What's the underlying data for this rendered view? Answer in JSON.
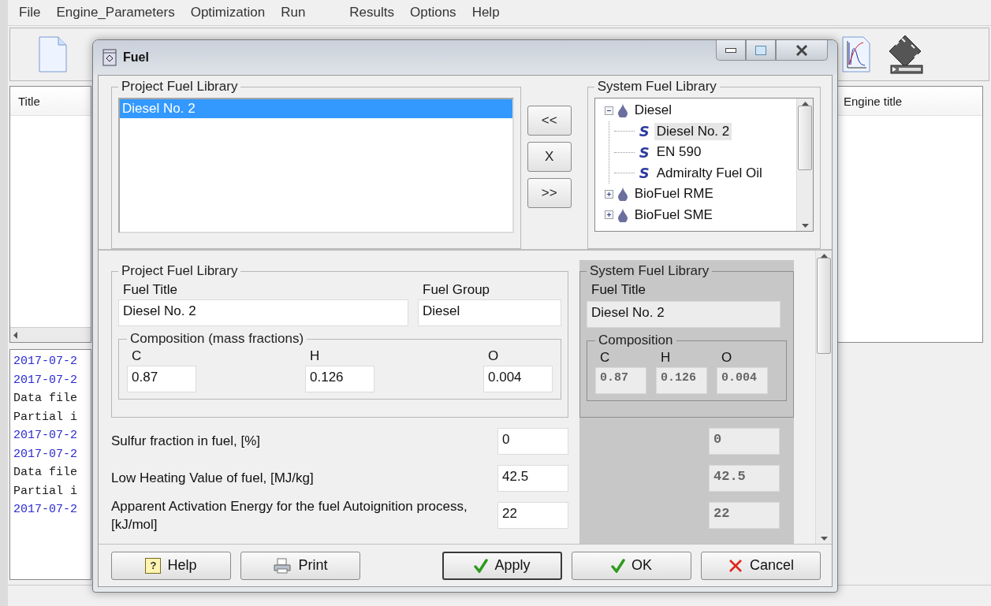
{
  "menu": [
    "File",
    "Engine_Parameters",
    "Optimization",
    "Run",
    "Results",
    "Options",
    "Help"
  ],
  "left_panel": {
    "column": "Title"
  },
  "right_panel": {
    "column": "Engine title"
  },
  "log": [
    {
      "text": "2017-07-2",
      "color": "#2a2ad0"
    },
    {
      "text": "2017-07-2",
      "color": "#2a2ad0"
    },
    {
      "text": "Data file",
      "color": "#1a1a1a"
    },
    {
      "text": "Partial i",
      "color": "#1a1a1a"
    },
    {
      "text": "2017-07-2",
      "color": "#2a2ad0"
    },
    {
      "text": "2017-07-2",
      "color": "#2a2ad0"
    },
    {
      "text": "Data file",
      "color": "#1a1a1a"
    },
    {
      "text": "Partial i",
      "color": "#1a1a1a"
    },
    {
      "text": "2017-07-2",
      "color": "#2a2ad0"
    }
  ],
  "dialog": {
    "title": "Fuel",
    "project_library": {
      "title": "Project Fuel Library",
      "items": [
        {
          "label": "Diesel No. 2",
          "selected": true
        }
      ]
    },
    "transfer_buttons": [
      "<<",
      "X",
      ">>"
    ],
    "system_library": {
      "title": "System Fuel Library",
      "tree": [
        {
          "label": "Diesel",
          "expanded": true,
          "selected": false,
          "children": [
            {
              "label": "Diesel No. 2",
              "glyph": "S",
              "selected": true
            },
            {
              "label": "EN 590",
              "glyph": "S",
              "selected": false
            },
            {
              "label": "Admiralty Fuel Oil",
              "glyph": "S",
              "selected": false
            }
          ]
        },
        {
          "label": "BioFuel RME",
          "expanded": false,
          "selected": false
        },
        {
          "label": "BioFuel SME",
          "expanded": false,
          "selected": false
        }
      ]
    },
    "project_details": {
      "title": "Project Fuel Library",
      "fuel_title_label": "Fuel Title",
      "fuel_title": "Diesel No. 2",
      "fuel_group_label": "Fuel Group",
      "fuel_group": "Diesel",
      "composition_title": "Composition (mass fractions)",
      "composition": [
        {
          "label": "C",
          "value": "0.87"
        },
        {
          "label": "H",
          "value": "0.126"
        },
        {
          "label": "O",
          "value": "0.004"
        }
      ]
    },
    "system_details": {
      "title": "System Fuel Library",
      "disabled": true,
      "fuel_title_label": "Fuel Title",
      "fuel_title": "Diesel No. 2",
      "composition_title": "Composition",
      "composition": [
        {
          "label": "C",
          "value": "0.87"
        },
        {
          "label": "H",
          "value": "0.126"
        },
        {
          "label": "O",
          "value": "0.004"
        }
      ]
    },
    "parameters": [
      {
        "label": "Sulfur fraction in fuel, [%]",
        "value": "0",
        "system_value": "0"
      },
      {
        "label": "Low Heating Value of fuel, [MJ/kg]",
        "value": "42.5",
        "system_value": "42.5"
      },
      {
        "label": "Apparent Activation Energy for the fuel Autoignition process, [kJ/mol]",
        "value": "22",
        "system_value": "22"
      }
    ],
    "buttons": [
      {
        "label": "Help",
        "kind": "help",
        "glyph": "?",
        "focused": false
      },
      {
        "label": "Print",
        "kind": "print",
        "focused": false
      },
      {
        "label": "Apply",
        "kind": "apply",
        "focused": true
      },
      {
        "label": "OK",
        "kind": "ok",
        "focused": false
      },
      {
        "label": "Cancel",
        "kind": "cancel",
        "focused": false
      }
    ]
  }
}
